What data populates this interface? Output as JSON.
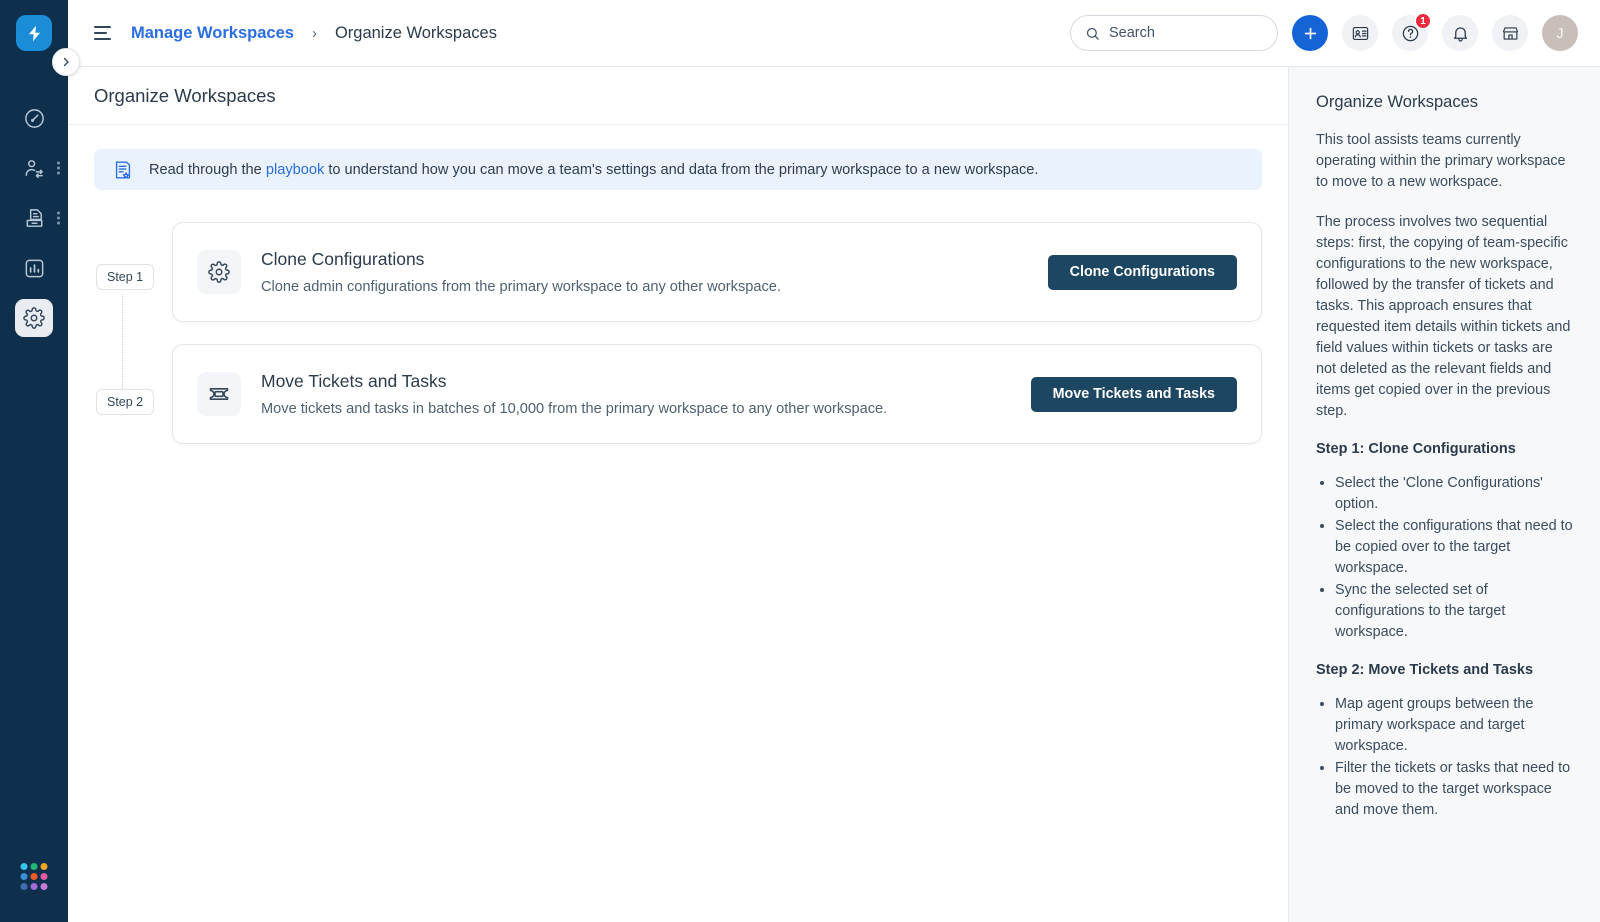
{
  "colors": {
    "rail_bg": "#0f304c",
    "logo_bg": "#1a8cd8",
    "accent_blue": "#2a6ee0",
    "primary_btn": "#1464d6",
    "dark_btn": "#1d4663",
    "badge_red": "#ec2b3f",
    "banner_bg": "#eaf2fd",
    "help_bg": "#f7f8fa"
  },
  "rail": {
    "logo_icon": "lightning-bolt-icon",
    "collapse_icon": "chevron-right-icon",
    "items": [
      {
        "icon": "dashboard-speedometer-icon",
        "name": "sidebar-item-dashboard",
        "active": false,
        "kebab": false
      },
      {
        "icon": "agent-switch-icon",
        "name": "sidebar-item-agents",
        "active": false,
        "kebab": true
      },
      {
        "icon": "document-archive-icon",
        "name": "sidebar-item-documents",
        "active": false,
        "kebab": true
      },
      {
        "icon": "bar-chart-icon",
        "name": "sidebar-item-analytics",
        "active": false,
        "kebab": false
      },
      {
        "icon": "gear-icon",
        "name": "sidebar-item-settings",
        "active": true,
        "kebab": false
      }
    ],
    "app_switcher_icon": "app-grid-icon",
    "app_switcher_colors": [
      "#35c5ef",
      "#22b573",
      "#f5a623",
      "#3d8fd6",
      "#f05a28",
      "#e05c9f",
      "#3d6fb0",
      "#a26bd6",
      "#c77bd9"
    ]
  },
  "topbar": {
    "menu_icon": "hamburger-menu-icon",
    "breadcrumb_parent": "Manage Workspaces",
    "breadcrumb_separator": "›",
    "breadcrumb_current": "Organize Workspaces",
    "search": {
      "icon": "search-icon",
      "placeholder": "Search",
      "value": ""
    },
    "actions": [
      {
        "name": "add-new-button",
        "icon": "plus-icon",
        "badge": ""
      },
      {
        "name": "contacts-button",
        "icon": "contact-card-icon",
        "badge": ""
      },
      {
        "name": "help-button",
        "icon": "question-circle-icon",
        "badge": "1"
      },
      {
        "name": "notifications-button",
        "icon": "bell-icon",
        "badge": ""
      },
      {
        "name": "marketplace-button",
        "icon": "store-icon",
        "badge": ""
      }
    ],
    "avatar_initial": "J"
  },
  "page": {
    "title": "Organize Workspaces",
    "banner": {
      "icon": "playbook-document-icon",
      "text_before": "Read through the",
      "link": "playbook",
      "text_after": "to understand how you can move a team's settings and data from the primary workspace to a new workspace."
    },
    "steps": [
      {
        "badge": "Step 1",
        "icon": "gear-icon",
        "title": "Clone Configurations",
        "description": "Clone admin configurations from the primary workspace to any other workspace.",
        "button": "Clone Configurations"
      },
      {
        "badge": "Step 2",
        "icon": "ticket-icon",
        "title": "Move Tickets and Tasks",
        "description": "Move tickets and tasks in batches of 10,000 from the primary workspace to any other workspace.",
        "button": "Move Tickets and Tasks"
      }
    ]
  },
  "help": {
    "title": "Organize Workspaces",
    "paragraph_1": "This tool assists teams currently operating within the primary workspace to move to a new workspace.",
    "paragraph_2": "The process involves two sequential steps: first, the copying of team-specific configurations to the new workspace, followed by the transfer of tickets and tasks. This approach ensures that requested item details within tickets and field values within tickets or tasks are not deleted as the relevant fields and items get copied over in the previous step.",
    "step1_heading": "Step 1: Clone Configurations",
    "step1_bullets": [
      "Select the 'Clone Configurations' option.",
      "Select the configurations that need to be copied over to the target workspace.",
      "Sync the selected set of configurations to the target workspace."
    ],
    "step2_heading": "Step 2: Move Tickets and Tasks",
    "step2_bullets": [
      "Map agent groups between the primary workspace and target workspace.",
      "Filter the tickets or tasks that need to be moved to the target workspace and move them."
    ]
  }
}
